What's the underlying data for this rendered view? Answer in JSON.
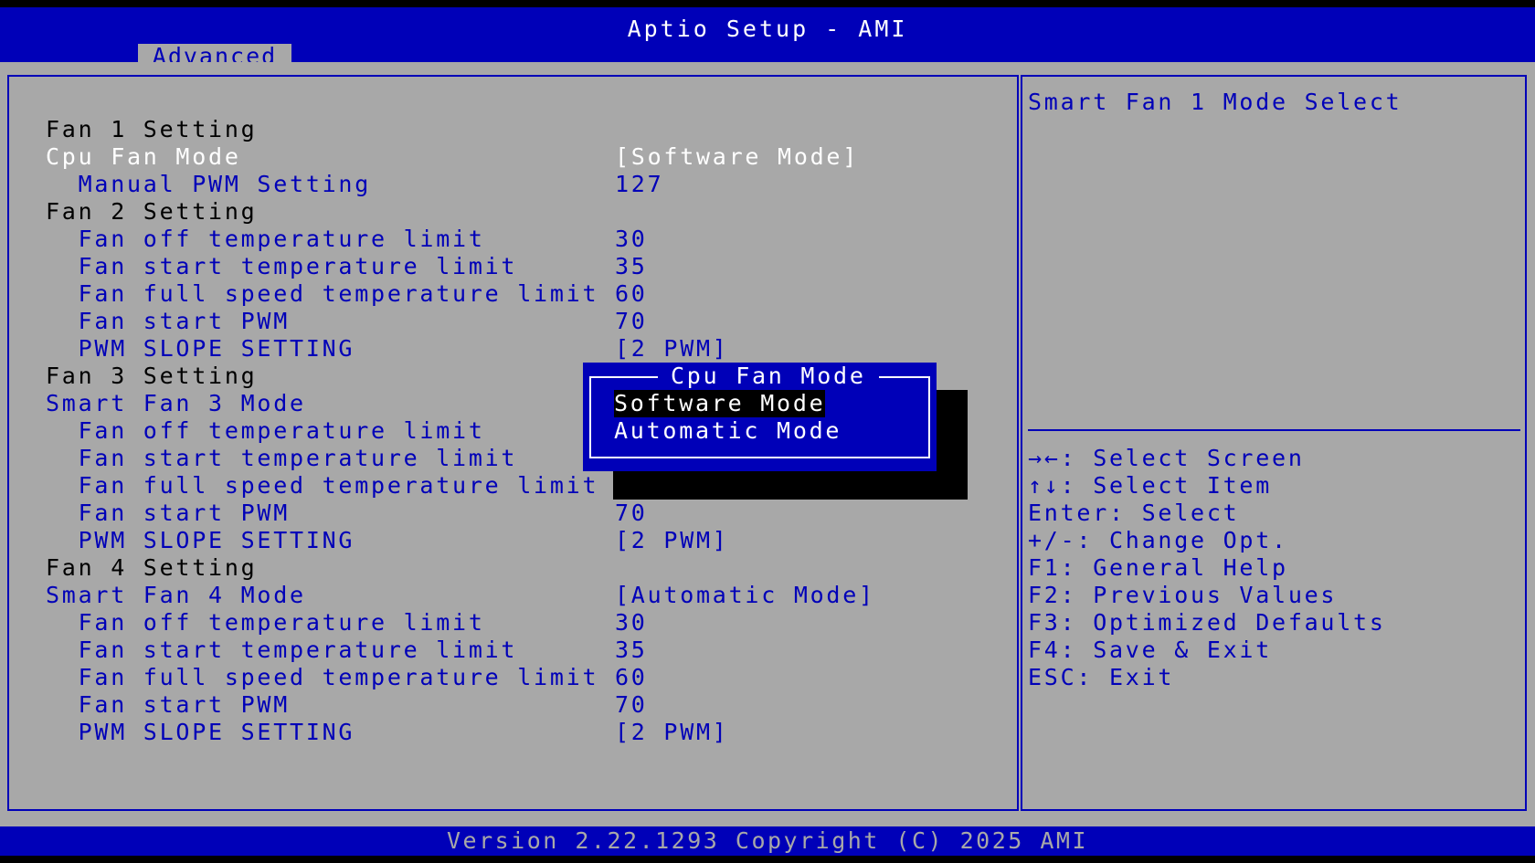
{
  "app_title": "Aptio Setup - AMI",
  "tab_label": "Advanced",
  "settings": [
    {
      "label": "Fan 1 Setting",
      "value": "",
      "kind": "heading"
    },
    {
      "label": "Cpu Fan Mode",
      "value": "[Software Mode]",
      "kind": "selected"
    },
    {
      "label": "  Manual PWM Setting",
      "value": "127",
      "kind": "item"
    },
    {
      "label": "Fan 2 Setting",
      "value": "",
      "kind": "heading"
    },
    {
      "label": "  Fan off temperature limit",
      "value": "30",
      "kind": "item"
    },
    {
      "label": "  Fan start temperature limit",
      "value": "35",
      "kind": "item"
    },
    {
      "label": "  Fan full speed temperature limit",
      "value": "60",
      "kind": "item"
    },
    {
      "label": "  Fan start PWM",
      "value": "70",
      "kind": "item"
    },
    {
      "label": "  PWM SLOPE SETTING",
      "value": "[2 PWM]",
      "kind": "item"
    },
    {
      "label": "Fan 3 Setting",
      "value": "",
      "kind": "heading"
    },
    {
      "label": "Smart Fan 3 Mode",
      "value": "",
      "kind": "item"
    },
    {
      "label": "  Fan off temperature limit",
      "value": "",
      "kind": "item"
    },
    {
      "label": "  Fan start temperature limit",
      "value": "",
      "kind": "item"
    },
    {
      "label": "  Fan full speed temperature limit",
      "value": "",
      "kind": "item"
    },
    {
      "label": "  Fan start PWM",
      "value": "70",
      "kind": "item"
    },
    {
      "label": "  PWM SLOPE SETTING",
      "value": "[2 PWM]",
      "kind": "item"
    },
    {
      "label": "Fan 4 Setting",
      "value": "",
      "kind": "heading"
    },
    {
      "label": "Smart Fan 4 Mode",
      "value": "[Automatic Mode]",
      "kind": "item"
    },
    {
      "label": "  Fan off temperature limit",
      "value": "30",
      "kind": "item"
    },
    {
      "label": "  Fan start temperature limit",
      "value": "35",
      "kind": "item"
    },
    {
      "label": "  Fan full speed temperature limit",
      "value": "60",
      "kind": "item"
    },
    {
      "label": "  Fan start PWM",
      "value": "70",
      "kind": "item"
    },
    {
      "label": "  PWM SLOPE SETTING",
      "value": "[2 PWM]",
      "kind": "item"
    }
  ],
  "help_text": "Smart Fan 1 Mode Select",
  "key_help": [
    "→←: Select Screen",
    "↑↓: Select Item",
    "Enter: Select",
    "+/-: Change Opt.",
    "F1: General Help",
    "F2: Previous Values",
    "F3: Optimized Defaults",
    "F4: Save & Exit",
    "ESC: Exit"
  ],
  "popup": {
    "title": "Cpu Fan Mode",
    "options": [
      "Software Mode",
      "Automatic Mode"
    ],
    "selected_index": 0
  },
  "footer_text": "Version 2.22.1293 Copyright (C) 2025 AMI",
  "colors": {
    "bios_blue": "#0000b8",
    "panel_gray": "#a8a8a8",
    "highlight_white": "#ffffff",
    "black": "#000000"
  }
}
